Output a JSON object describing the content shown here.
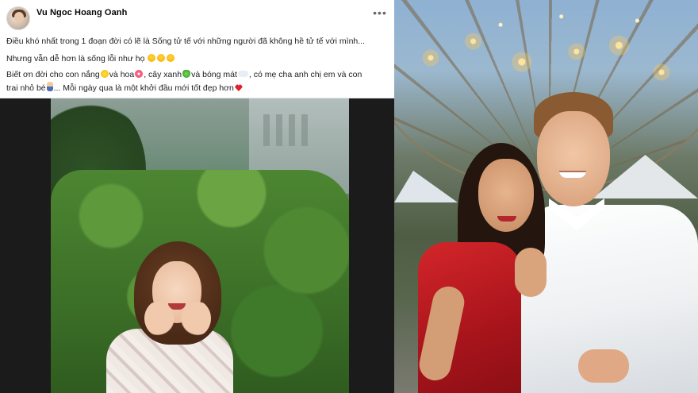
{
  "post": {
    "author": "Vu Ngoc Hoang Oanh",
    "more_icon": "ellipsis-icon",
    "line1": "Điều khó nhất trong 1 đoạn đời có lẽ là Sống tử tế với những người đã không hề tử tế với mình...",
    "line2_text": "Nhưng vẫn dễ hơn là sống lỗi như họ",
    "line3_a": "Biết ơn đời cho con nắng",
    "line3_b": "và hoa",
    "line3_c": ", cây xanh",
    "line3_d": "và bóng mát",
    "line3_e": ", có mẹ cha anh chị em và con",
    "line4_a": "trai nhỏ bé",
    "line4_b": "... Mỗi ngày qua là một khởi đầu mới tốt đẹp hơn",
    "emoji_icons": [
      "laughing-face-icon",
      "sun-icon",
      "flower-icon",
      "clover-icon",
      "cloud-icon",
      "boy-icon",
      "red-heart-icon"
    ]
  },
  "colors": {
    "post_bg": "#ffffff",
    "text": "#1c1e21",
    "author": "#050505",
    "muted": "#65676b",
    "photo_frame": "#1b1b1b"
  }
}
